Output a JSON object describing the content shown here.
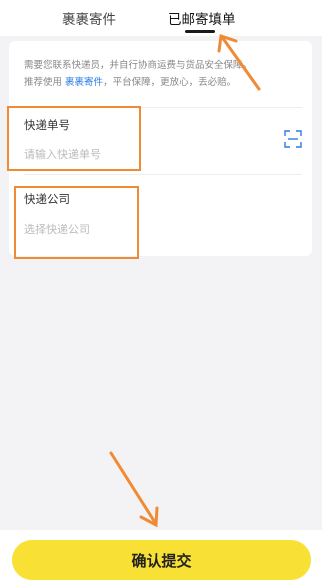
{
  "tabs": [
    {
      "label": "裹裹寄件",
      "active": false
    },
    {
      "label": "已邮寄填单",
      "active": true
    }
  ],
  "notice": {
    "line1": "需要您联系快递员，并自行协商运费与货品安全保障。",
    "line2_prefix": "推荐使用",
    "line2_link": "裹裹寄件",
    "line2_suffix": "，平台保障，更放心，丢必赔。"
  },
  "tracking": {
    "label": "快递单号",
    "placeholder": "请输入快递单号",
    "scan_icon": "scan-icon"
  },
  "courier": {
    "label": "快递公司",
    "placeholder": "选择快递公司"
  },
  "footer": {
    "confirm_label": "确认提交"
  },
  "colors": {
    "accent": "#f9e034",
    "annotation": "#f08a34",
    "link": "#2c7be5"
  }
}
